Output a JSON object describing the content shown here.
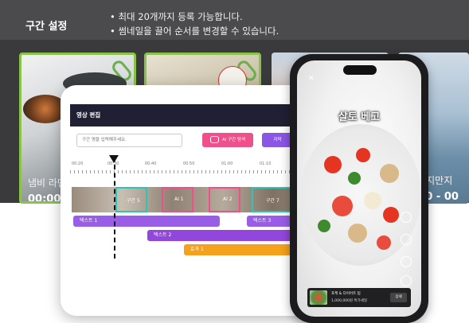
{
  "section": {
    "title": "구간 설정",
    "notes": [
      "• 최대 20개까지 등록 가능합니다.",
      "• 썸네일을 끌어 순서를 변경할 수 있습니다."
    ]
  },
  "thumbnails": [
    {
      "label": "냄비 라면",
      "time": "00:00:"
    },
    {
      "label": "",
      "time": ""
    },
    {
      "label": "",
      "time": ""
    },
    {
      "label": "글자까지만지",
      "time": "00:00 - 00"
    }
  ],
  "editor": {
    "title": "영상 편집",
    "input_placeholder": "구간 명을 입력해주세요.",
    "ai_button": "AI 구간 탐색",
    "subtitle_button": "자막",
    "ruler_ticks": [
      "00:20",
      "00:30",
      "00:40",
      "00:50",
      "01:00",
      "01:10"
    ],
    "segments": [
      "구간 5",
      "AI 1",
      "AI 2",
      "구간 7"
    ],
    "tracks": [
      "텍스트 1",
      "텍스트 3",
      "텍스트 2",
      "효과 1"
    ]
  },
  "phone": {
    "title": "살토 베고",
    "banner_line1": "포케 & 다이어트 팁",
    "banner_line2": "1,000,000원 특가세일",
    "banner_button": "상세"
  },
  "colors": {
    "selected_border": "#8bc34a",
    "ai_pink": "#ef4f8a",
    "subtitle_purple": "#8b55e6",
    "effect_orange": "#f5a11b",
    "segment_teal": "#2ec4b6"
  }
}
